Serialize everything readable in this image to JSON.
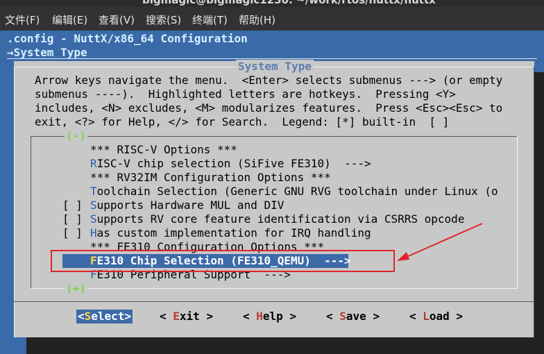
{
  "window_title_partial": "bigmagic@bigmagic1230: ~/work/rtos/nuttx/nuttx",
  "menu": [
    {
      "label": "文件(F)"
    },
    {
      "label": "编辑(E)"
    },
    {
      "label": "查看(V)"
    },
    {
      "label": "搜索(S)"
    },
    {
      "label": "终端(T)"
    },
    {
      "label": "帮助(H)"
    }
  ],
  "header": {
    "config_title": ".config - NuttX/x86_64 Configuration",
    "breadcrumb": "→System Type"
  },
  "dialog": {
    "title": "System Type",
    "help_text": "Arrow keys navigate the menu.  <Enter> selects submenus ---> (or empty\nsubmenus ----).  Highlighted letters are hotkeys.  Pressing <Y>\nincludes, <N> excludes, <M> modularizes features.  Press <Esc><Esc> to\nexit, <?> for Help, </> for Search.  Legend: [*] built-in  [ ]",
    "scroll_up": "(-)",
    "scroll_down": "(+)",
    "items": [
      {
        "prefix": "",
        "hotkey": "",
        "text": "*** RISC-V Options ***",
        "selected": false
      },
      {
        "prefix": "",
        "hotkey": "R",
        "text": "ISC-V chip selection (SiFive FE310)  --->",
        "selected": false
      },
      {
        "prefix": "",
        "hotkey": "",
        "text": "*** RV32IM Configuration Options ***",
        "selected": false
      },
      {
        "prefix": "",
        "hotkey": "T",
        "text": "oolchain Selection (Generic GNU RVG toolchain under Linux (o",
        "selected": false
      },
      {
        "prefix": "[ ] ",
        "hotkey": "S",
        "text": "upports Hardware MUL and DIV",
        "selected": false
      },
      {
        "prefix": "[ ] ",
        "hotkey": "S",
        "text": "upports RV core feature identification via CSRRS opcode",
        "selected": false
      },
      {
        "prefix": "[ ] ",
        "hotkey": "H",
        "text": "as custom implementation for IRQ handling",
        "selected": false
      },
      {
        "prefix": "",
        "hotkey": "",
        "text": "*** FE310 Configuration Options ***",
        "selected": false
      },
      {
        "prefix": "",
        "hotkey": "F",
        "text": "E310 Chip Selection (FE310_QEMU)  --->",
        "selected": true
      },
      {
        "prefix": "",
        "hotkey": "F",
        "text": "E310 Peripheral Support  --->",
        "selected": false
      }
    ],
    "buttons": [
      {
        "pre": "<",
        "key": "S",
        "rest": "elect>",
        "active": true
      },
      {
        "pre": "< ",
        "key": "E",
        "rest": "xit >",
        "active": false
      },
      {
        "pre": "< ",
        "key": "H",
        "rest": "elp >",
        "active": false
      },
      {
        "pre": "< ",
        "key": "S",
        "rest": "ave >",
        "active": false
      },
      {
        "pre": "< ",
        "key": "L",
        "rest": "oad >",
        "active": false
      }
    ]
  },
  "colors": {
    "terminal_bg": "#3a6aa8",
    "dialog_bg": "#c8c8c8",
    "highlight_bg": "#3d6aa8",
    "annotation": "#e0242b"
  }
}
